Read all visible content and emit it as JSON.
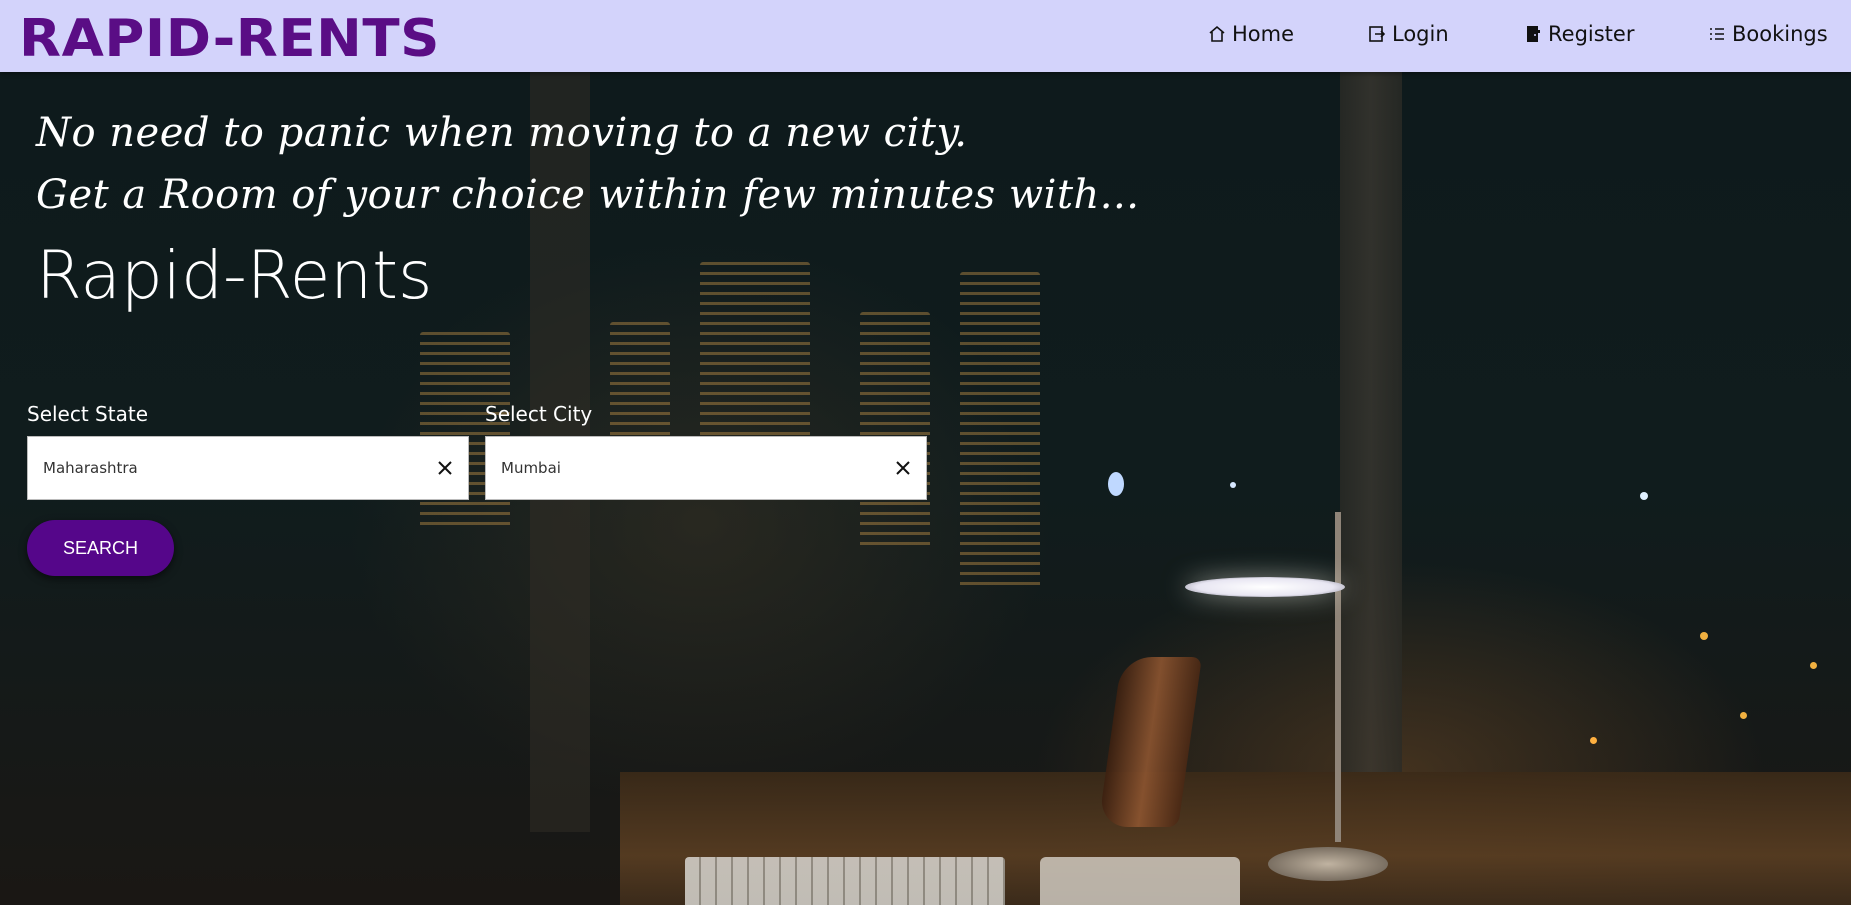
{
  "navbar": {
    "brand": "RAPID-RENTS",
    "items": [
      {
        "label": "Home",
        "icon": "home-icon"
      },
      {
        "label": "Login",
        "icon": "login-icon"
      },
      {
        "label": "Register",
        "icon": "register-icon"
      },
      {
        "label": "Bookings",
        "icon": "list-icon"
      }
    ]
  },
  "hero": {
    "tagline_1": "No need to panic when moving to a new city.",
    "tagline_2": "Get a Room of your choice within few minutes with...",
    "title": "Rapid-Rents"
  },
  "search": {
    "state_label": "Select State",
    "state_value": "Maharashtra",
    "city_label": "Select City",
    "city_value": "Mumbai",
    "button_label": "SEARCH"
  },
  "colors": {
    "brand": "#5a0d85",
    "navbar_bg": "#d3d3fb",
    "button_bg": "#55068a"
  }
}
